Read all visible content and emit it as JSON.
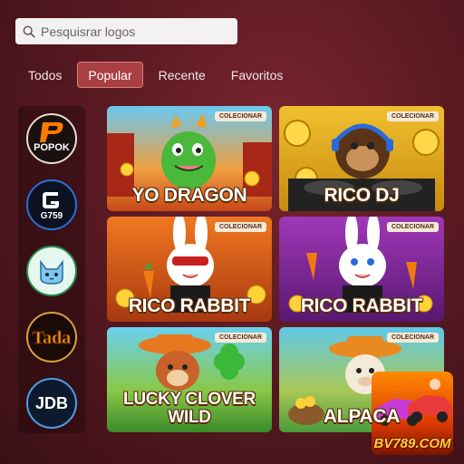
{
  "search": {
    "placeholder": "Pesquisrar logos"
  },
  "tabs": [
    {
      "label": "Todos"
    },
    {
      "label": "Popular",
      "active": true
    },
    {
      "label": "Recente"
    },
    {
      "label": "Favoritos"
    }
  ],
  "sidebar": {
    "providers": [
      {
        "label": "POPOK",
        "icon": "popok-logo-icon"
      },
      {
        "label": "G759",
        "icon": "g759-logo-icon"
      },
      {
        "label": "",
        "icon": "cat-logo-icon"
      },
      {
        "label": "Tada",
        "icon": "tada-logo-icon"
      },
      {
        "label": "JDB",
        "icon": "jdb-logo-icon"
      }
    ]
  },
  "games": [
    {
      "title": "YO DRAGON",
      "badge": "COLECIONAR"
    },
    {
      "title": "RICO DJ",
      "badge": "COLECIONAR"
    },
    {
      "title": "RICO RABBIT",
      "badge": "COLECIONAR"
    },
    {
      "title": "RICO RABBIT",
      "badge": "COLECIONAR"
    },
    {
      "title": "LUCKY CLOVER WILD",
      "badge": "COLECIONAR"
    },
    {
      "title": "ALPACA",
      "badge": "COLECIONAR"
    }
  ],
  "promo": {
    "brand": "BV789.COM"
  },
  "colors": {
    "accent": "#a93e43",
    "background": "#5a1a22"
  }
}
